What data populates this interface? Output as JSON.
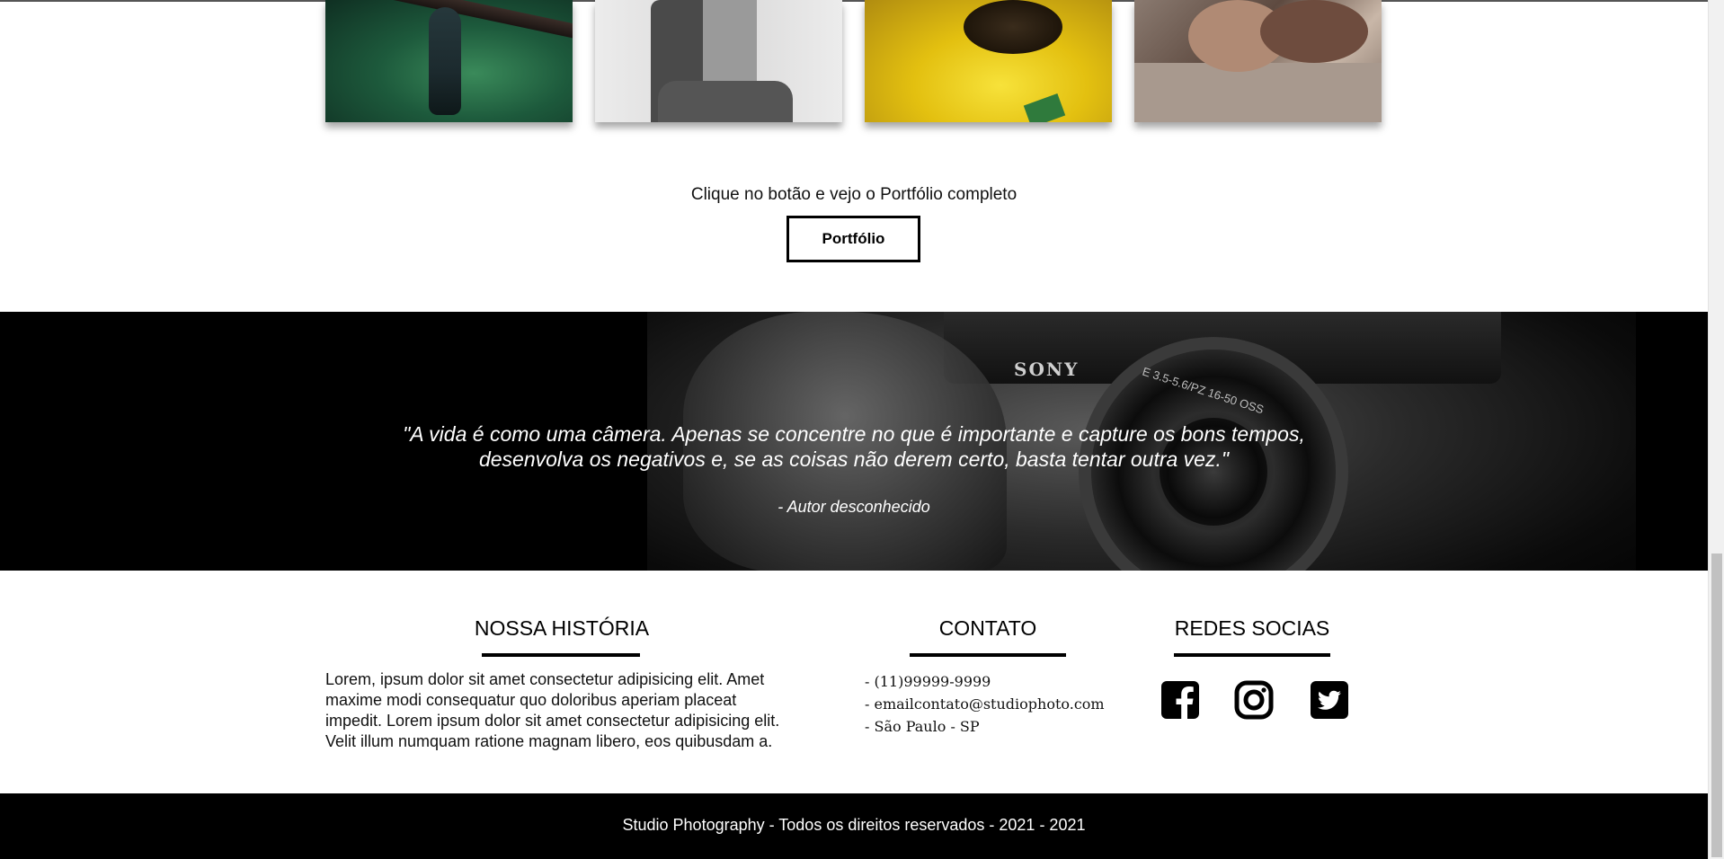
{
  "gallery": {
    "photos": [
      {
        "name": "hummingbird-photo"
      },
      {
        "name": "couple-photo"
      },
      {
        "name": "bee-flower-photo"
      },
      {
        "name": "baby-photo"
      }
    ]
  },
  "portfolio_cta": {
    "text": "Clique no botão e vejo o Portfólio completo",
    "button_label": "Portfólio"
  },
  "banner": {
    "quote": "\"A vida é como uma câmera. Apenas se concentre no que é importante e capture os bons tempos, desenvolva os negativos e, se as coisas não derem certo, basta tentar outra vez.\"",
    "author": "- Autor desconhecido",
    "camera_brand": "SONY",
    "lens_text": "E 3.5-5.6/PZ 16-50 OSS"
  },
  "history": {
    "title": "NOSSA HISTÓRIA",
    "text": "Lorem, ipsum dolor sit amet consectetur adipisicing elit. Amet maxime modi consequatur quo doloribus aperiam placeat impedit. Lorem ipsum dolor sit amet consectetur adipisicing elit. Velit illum numquam ratione magnam libero, eos quibusdam a."
  },
  "contact": {
    "title": "CONTATO",
    "items": [
      "- (11)99999-9999",
      "- emailcontato@studiophoto.com",
      "- São Paulo - SP"
    ]
  },
  "social": {
    "title": "REDES SOCIAS",
    "icons": [
      "facebook-icon",
      "instagram-icon",
      "twitter-icon"
    ]
  },
  "footer": {
    "copyright": "Studio Photography - Todos os direitos reservados - 2021 - 2021"
  },
  "colors": {
    "background": "#ffffff",
    "banner": "#000000",
    "text": "#111111",
    "accent": "#000000"
  }
}
